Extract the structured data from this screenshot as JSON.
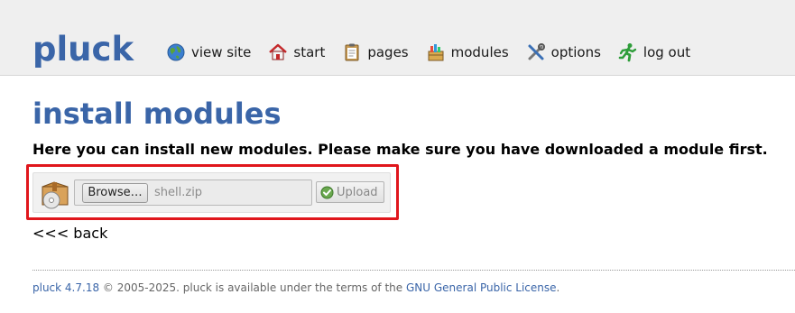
{
  "header": {
    "logo": "pluck",
    "nav": [
      {
        "label": "view site",
        "icon": "globe-icon"
      },
      {
        "label": "start",
        "icon": "home-icon"
      },
      {
        "label": "pages",
        "icon": "clipboard-icon"
      },
      {
        "label": "modules",
        "icon": "modules-box-icon"
      },
      {
        "label": "options",
        "icon": "tools-icon"
      },
      {
        "label": "log out",
        "icon": "running-man-icon"
      }
    ]
  },
  "main": {
    "title": "install modules",
    "intro": "Here you can install new modules. Please make sure you have downloaded a module first.",
    "upload": {
      "package_icon": "package-icon",
      "browse_label": "Browse…",
      "file_name": "shell.zip",
      "upload_label": "Upload",
      "upload_icon": "check-circle-icon"
    },
    "back_link": "<<< back"
  },
  "footer": {
    "version_link": "pluck 4.7.18",
    "text": " © 2005-2025. pluck is available under the terms of the ",
    "license_link": "GNU General Public License",
    "end": "."
  },
  "colors": {
    "brand": "#3a65a8",
    "highlight": "#e0161c",
    "header_bg": "#efefef"
  }
}
